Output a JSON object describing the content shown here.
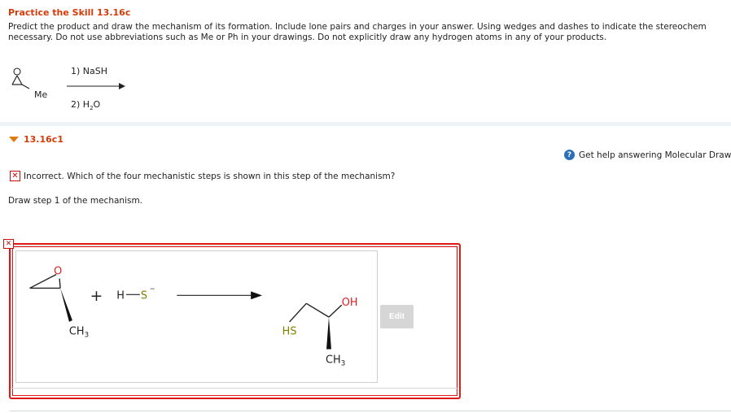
{
  "header": {
    "title": "Practice the Skill 13.16c",
    "instruction_line1": "Predict the product and draw the mechanism of its formation. Include lone pairs and charges in your answer. Using wedges and dashes to indicate the stereochem",
    "instruction_line2": "necessary. Do not use abbreviations such as Me or Ph in your drawings. Do not explicitly draw any hydrogen atoms in any of your products."
  },
  "reaction": {
    "reagent1": "1) NaSH",
    "reagent2_prefix": "2) H",
    "reagent2_sub": "2",
    "reagent2_suffix": "O",
    "substituent_label": "Me",
    "epoxide_o": "O"
  },
  "part": {
    "label": "13.16c1"
  },
  "help": {
    "icon_glyph": "?",
    "text": "Get help answering Molecular Draw"
  },
  "feedback": {
    "icon_glyph": "✕",
    "text": "Incorrect. Which of the four mechanistic steps is shown in this step of the mechanism?"
  },
  "step_prompt": "Draw step 1 of the mechanism.",
  "drawing": {
    "reactant_o": "O",
    "reactant_ch": "CH",
    "reactant_sub": "3",
    "plus": "+",
    "nucleophile_h": "H",
    "nucleophile_s": "S",
    "nucleophile_charge": "−",
    "product_oh": "OH",
    "product_hs": "HS",
    "product_ch": "CH",
    "product_sub": "3"
  },
  "edit_button": "Edit",
  "small_marker": "✕",
  "colors": {
    "title": "#d23c0a",
    "error": "#e01818",
    "oxygen": "#e02020",
    "sulfur": "#808000"
  }
}
